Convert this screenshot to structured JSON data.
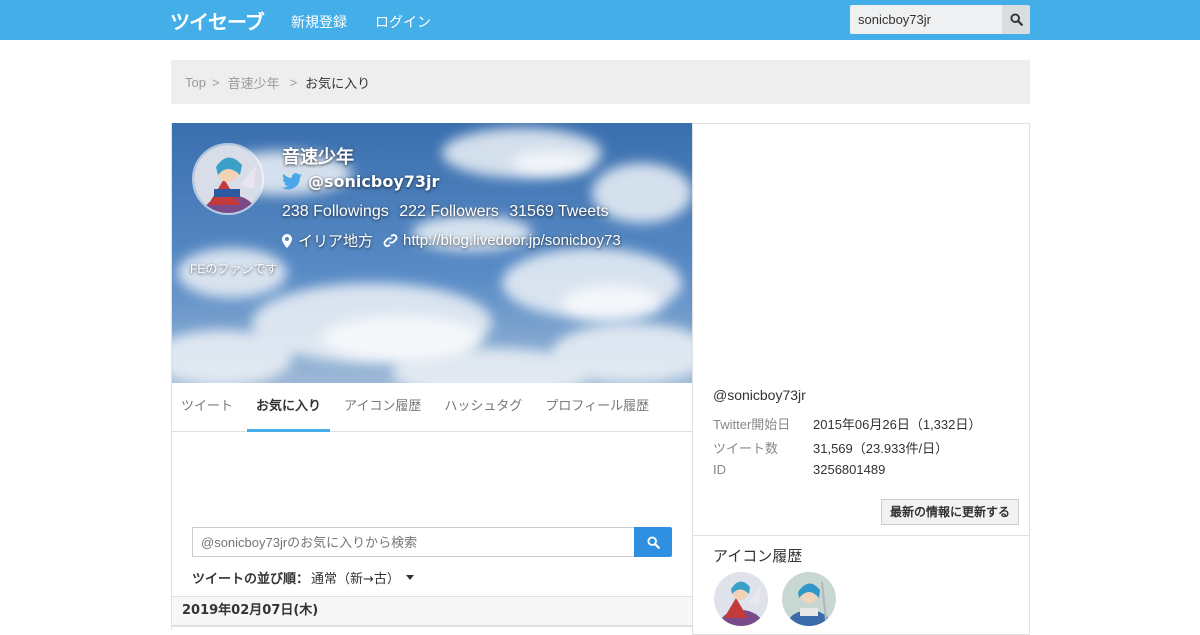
{
  "navbar": {
    "brand": "ツイセーブ",
    "signup_label": "新規登録",
    "login_label": "ログイン",
    "search_value": "sonicboy73jr",
    "accent_color": "#44aee9"
  },
  "breadcrumb": {
    "items": [
      "Top",
      "音速少年",
      "お気に入り"
    ],
    "separator": ">"
  },
  "profile": {
    "name": "音速少年",
    "handle": "@sonicboy73jr",
    "followings": "238 Followings",
    "followers": "222 Followers",
    "tweets": "31569 Tweets",
    "location": "イリア地方",
    "url": "http://blog.livedoor.jp/sonicboy73",
    "bio": "FEのファンです"
  },
  "tabs": [
    {
      "label": "ツイート",
      "active": false
    },
    {
      "label": "お気に入り",
      "active": true
    },
    {
      "label": "アイコン履歴",
      "active": false
    },
    {
      "label": "ハッシュタグ",
      "active": false
    },
    {
      "label": "プロフィール履歴",
      "active": false
    }
  ],
  "favorites": {
    "search_placeholder": "@sonicboy73jrのお気に入りから検索",
    "sort_label": "ツイートの並び順：",
    "sort_value": "通常（新→古）",
    "date_header": "2019年02月07日(木)"
  },
  "info": {
    "handle": "@sonicboy73jr",
    "rows": [
      {
        "key": "Twitter開始日",
        "value": "2015年06月26日（1,332日）"
      },
      {
        "key": "ツイート数",
        "value": "31,569（23.933件/日）"
      },
      {
        "key": "ID",
        "value": "3256801489"
      }
    ],
    "update_button": "最新の情報に更新する"
  },
  "icon_history": {
    "title": "アイコン履歴",
    "count": 2
  }
}
